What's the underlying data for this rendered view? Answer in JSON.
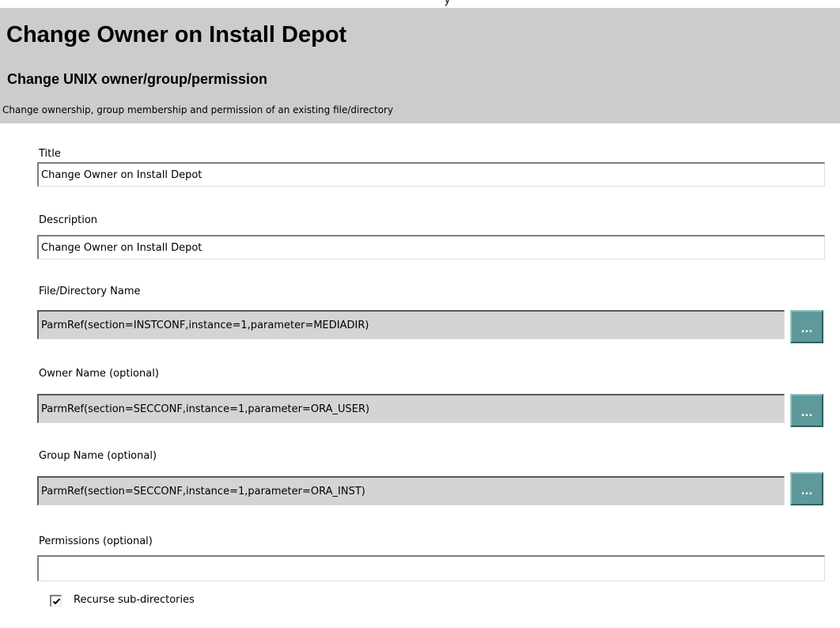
{
  "top_strip": {
    "text": "y"
  },
  "header": {
    "title": "Change Owner on Install Depot",
    "subtitle": "Change UNIX owner/group/permission",
    "description": "Change ownership, group membership and permission of an existing file/directory"
  },
  "form": {
    "title_label": "Title",
    "title_value": "Change Owner on Install Depot",
    "description_label": "Description",
    "description_value": "Change Owner on Install Depot",
    "file_label": "File/Directory Name",
    "file_value": "ParmRef(section=INSTCONF,instance=1,parameter=MEDIADIR)",
    "owner_label": "Owner Name (optional)",
    "owner_value": "ParmRef(section=SECCONF,instance=1,parameter=ORA_USER)",
    "group_label": "Group Name (optional)",
    "group_value": "ParmRef(section=SECCONF,instance=1,parameter=ORA_INST)",
    "permissions_label": "Permissions (optional)",
    "permissions_value": "",
    "browse_label": "...",
    "recurse_label": "Recurse sub-directories",
    "recurse_checked": true
  },
  "colors": {
    "header_bg": "#cccccc",
    "browse_button": "#5f9a9a",
    "readonly_field": "#d4d4d4"
  }
}
